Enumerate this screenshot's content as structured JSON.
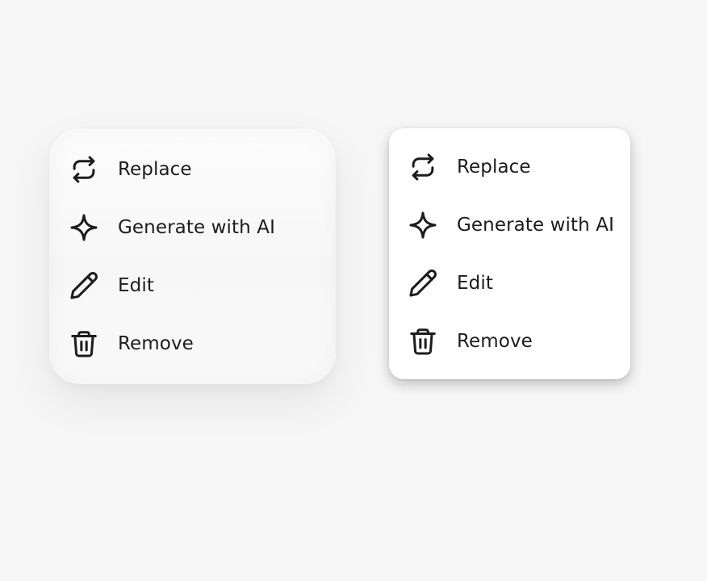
{
  "menus": [
    {
      "variant": "soft",
      "items": [
        {
          "label": "Replace",
          "icon": "replace-icon"
        },
        {
          "label": "Generate with AI",
          "icon": "sparkle-icon"
        },
        {
          "label": "Edit",
          "icon": "pencil-icon"
        },
        {
          "label": "Remove",
          "icon": "trash-icon"
        }
      ]
    },
    {
      "variant": "flat",
      "items": [
        {
          "label": "Replace",
          "icon": "replace-icon"
        },
        {
          "label": "Generate with AI",
          "icon": "sparkle-icon"
        },
        {
          "label": "Edit",
          "icon": "pencil-icon"
        },
        {
          "label": "Remove",
          "icon": "trash-icon"
        }
      ]
    }
  ],
  "colors": {
    "background": "#f6f6f6",
    "text": "#1c1c1c",
    "menu_surface": "#ffffff"
  }
}
